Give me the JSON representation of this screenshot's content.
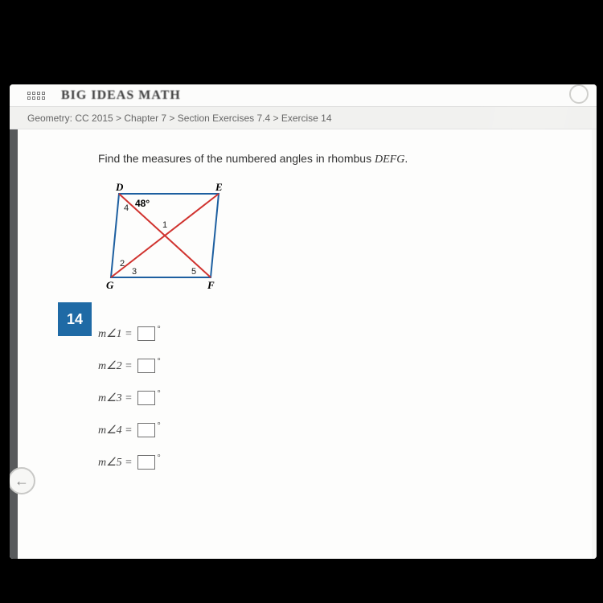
{
  "brand": "BIG IDEAS MATH",
  "breadcrumb": "Geometry: CC 2015 > Chapter 7 > Section Exercises 7.4 > Exercise 14",
  "exercise_number": "14",
  "prompt_prefix": "Find the measures of the numbered angles in rhombus ",
  "prompt_shape": "DEFG",
  "prompt_suffix": ".",
  "figure": {
    "vertices": {
      "tl": "D",
      "tr": "E",
      "bl": "G",
      "br": "F"
    },
    "given_angle_label": "48°",
    "angle_marks": {
      "a1": "1",
      "a2": "2",
      "a3": "3",
      "a4": "4",
      "a5": "5"
    }
  },
  "answers": [
    {
      "label": "m∠1 ="
    },
    {
      "label": "m∠2 ="
    },
    {
      "label": "m∠3 ="
    },
    {
      "label": "m∠4 ="
    },
    {
      "label": "m∠5 ="
    }
  ],
  "back_glyph": "←"
}
